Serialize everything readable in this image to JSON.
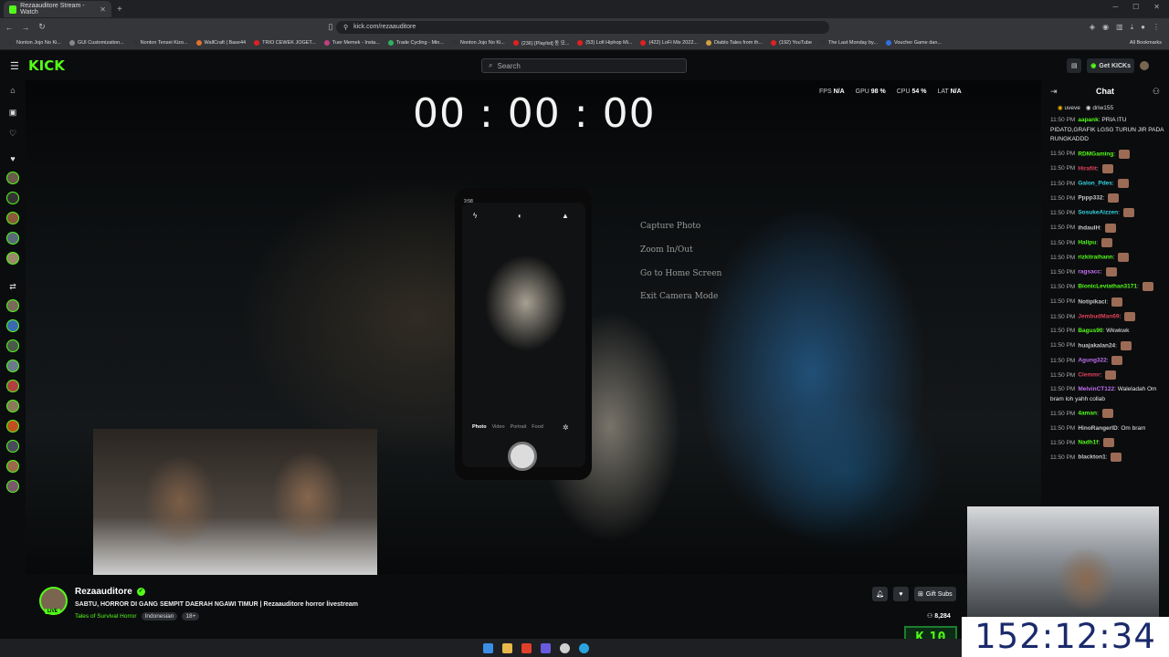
{
  "browser": {
    "tab_title": "Rezaauditore Stream - Watch",
    "url": "kick.com/rezaauditore",
    "bookmarks": [
      {
        "label": "Nonton Jojo No Ki...",
        "color": "#333"
      },
      {
        "label": "GUI Customization...",
        "color": "#888"
      },
      {
        "label": "Nonton Tensei Kizo...",
        "color": "#333"
      },
      {
        "label": "WallCraft | Base44",
        "color": "#e07030"
      },
      {
        "label": "TRIO CEWEK JOGET...",
        "color": "#e02020"
      },
      {
        "label": "Tuer Memek - Insta...",
        "color": "#c04080"
      },
      {
        "label": "Trade Cycling - Min...",
        "color": "#30b060"
      },
      {
        "label": "Nonton Jojo No Ki...",
        "color": "#333"
      },
      {
        "label": "(236) [Playlist] 동 모...",
        "color": "#e02020"
      },
      {
        "label": "(53) Lofi Hiphop Mi...",
        "color": "#e02020"
      },
      {
        "label": "(422) LoFi Mix 2022...",
        "color": "#e02020"
      },
      {
        "label": "Diablo Tales from th...",
        "color": "#d0a040"
      },
      {
        "label": "(192) YouTube",
        "color": "#e02020"
      },
      {
        "label": "The Last Monday by...",
        "color": "#333"
      },
      {
        "label": "Voucher Game dan...",
        "color": "#3070e0"
      }
    ],
    "all_bookmarks": "All Bookmarks"
  },
  "kick": {
    "logo": "KICK",
    "search_placeholder": "Search",
    "get_kicks": "Get KICKs"
  },
  "video": {
    "timer": "00 : 00 : 00",
    "perf": {
      "fps_label": "FPS",
      "fps": "N/A",
      "gpu_label": "GPU",
      "gpu": "98 %",
      "cpu_label": "CPU",
      "cpu": "54 %",
      "lat_label": "LAT",
      "lat": "N/A"
    },
    "phone_time": "3:58",
    "phone_modes": [
      "Photo",
      "Video",
      "Portrait",
      "Food"
    ],
    "hints": [
      "Capture Photo",
      "Zoom In/Out",
      "Go to Home Screen",
      "Exit Camera Mode"
    ]
  },
  "chat": {
    "title": "Chat",
    "pinned": [
      {
        "name": "uveve"
      },
      {
        "name": "driw155"
      }
    ],
    "messages": [
      {
        "time": "11:50 PM",
        "user": "aapank",
        "color": "#53fc18",
        "text": "PRIA ITU PIDATO,GRAFIK LGSG TURUN JIR PADA RUNGKADDD"
      },
      {
        "time": "11:50 PM",
        "user": "RDMGaming",
        "color": "#53fc18",
        "text": ""
      },
      {
        "time": "11:50 PM",
        "user": "Hirafiit",
        "color": "#e0405a",
        "text": ""
      },
      {
        "time": "11:50 PM",
        "user": "Galon_Pdes",
        "color": "#35d0e0",
        "text": ""
      },
      {
        "time": "11:50 PM",
        "user": "Pppp332",
        "color": "#c8c8c8",
        "text": ""
      },
      {
        "time": "11:50 PM",
        "user": "SosukeAizzen",
        "color": "#35d0e0",
        "text": ""
      },
      {
        "time": "11:50 PM",
        "user": "ihdaulH",
        "color": "#c8c8c8",
        "text": ""
      },
      {
        "time": "11:50 PM",
        "user": "Halipu",
        "color": "#53fc18",
        "text": ""
      },
      {
        "time": "11:50 PM",
        "user": "rizkiiraihann",
        "color": "#53fc18",
        "text": ""
      },
      {
        "time": "11:50 PM",
        "user": "ragsacc",
        "color": "#c070f0",
        "text": ""
      },
      {
        "time": "11:50 PM",
        "user": "BionicLeviathan3171",
        "color": "#53fc18",
        "text": ""
      },
      {
        "time": "11:50 PM",
        "user": "Notipikaci",
        "color": "#c8c8c8",
        "text": ""
      },
      {
        "time": "11:50 PM",
        "user": "JembudMan69",
        "color": "#e0405a",
        "text": ""
      },
      {
        "time": "11:50 PM",
        "user": "Bagus90",
        "color": "#53fc18",
        "text": "Wkwkwk"
      },
      {
        "time": "11:50 PM",
        "user": "huajakalan24",
        "color": "#c8c8c8",
        "text": ""
      },
      {
        "time": "11:50 PM",
        "user": "Agung322",
        "color": "#c070f0",
        "text": ""
      },
      {
        "time": "11:50 PM",
        "user": "Clemmr",
        "color": "#e0405a",
        "text": ""
      },
      {
        "time": "11:50 PM",
        "user": "MelvinCT122",
        "color": "#c070f0",
        "text": "Waleladah Om bram loh yahh collab"
      },
      {
        "time": "11:50 PM",
        "user": "4aman",
        "color": "#53fc18",
        "text": ""
      },
      {
        "time": "11:50 PM",
        "user": "HinoRangerID",
        "color": "#c8c8c8",
        "text": "Om bram"
      },
      {
        "time": "11:50 PM",
        "user": "Nadh1f",
        "color": "#53fc18",
        "text": ""
      },
      {
        "time": "11:50 PM",
        "user": "blackton1",
        "color": "#c8c8c8",
        "text": ""
      }
    ]
  },
  "channel": {
    "name": "Rezaauditore",
    "live_badge": "LIVE",
    "title": "SABTU, HORROR DI GANG SEMPIT DAERAH NGAWI TIMUR | Rezaauditore horror livestream",
    "category": "Tales of Survival Horror",
    "tags": [
      "Indonesian",
      "18+"
    ],
    "gift_subs": "Gift Subs",
    "viewers": "8,284"
  },
  "overlay": {
    "k10": "10",
    "timer": "152:12:34"
  },
  "colors": {
    "brand": "#53fc18",
    "background": "#0b0c0e"
  }
}
